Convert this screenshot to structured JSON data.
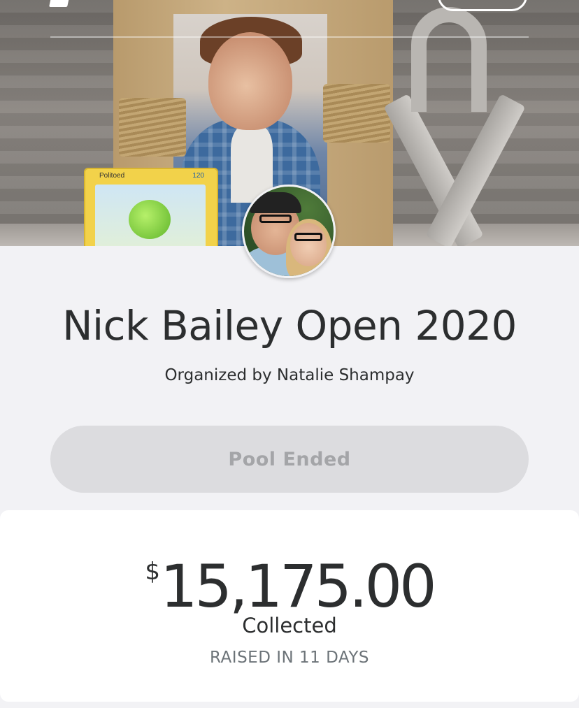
{
  "hero": {
    "card_name": "Politoed",
    "card_hp": "120"
  },
  "pool": {
    "title": "Nick Bailey Open 2020",
    "organizer": "Organized by Natalie Shampay",
    "status_button": "Pool Ended"
  },
  "summary": {
    "currency_symbol": "$",
    "amount": "15,175.00",
    "label": "Collected",
    "duration": "RAISED IN 11 DAYS"
  },
  "colors": {
    "background": "#f2f2f5",
    "text_primary": "#2c2e2f",
    "text_secondary": "#6c7378",
    "button_disabled_bg": "#dcdcdf",
    "button_disabled_text": "#a4a5a8"
  }
}
